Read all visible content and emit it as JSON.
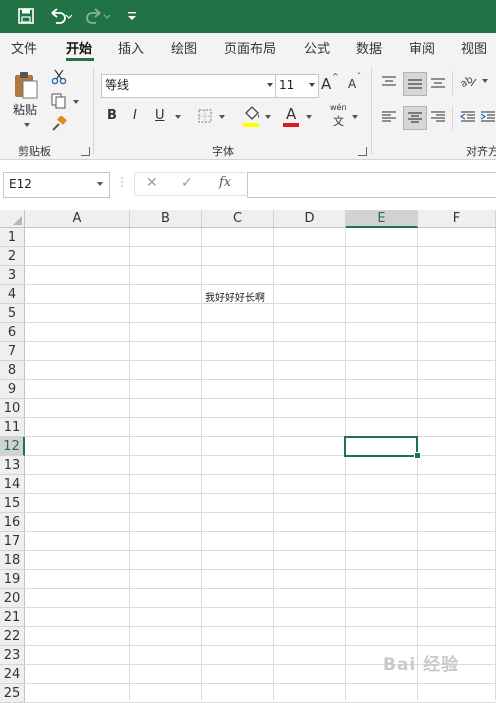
{
  "quick_access": {
    "icons": [
      "save-icon",
      "undo-icon",
      "redo-icon",
      "customize-icon"
    ]
  },
  "tabs": [
    "文件",
    "开始",
    "插入",
    "绘图",
    "页面布局",
    "公式",
    "数据",
    "审阅",
    "视图"
  ],
  "active_tab": "开始",
  "ribbon": {
    "clipboard": {
      "paste_label": "粘贴",
      "group_label": "剪贴板"
    },
    "font": {
      "font_name": "等线",
      "font_size": "11",
      "bold": "B",
      "italic": "I",
      "underline": "U",
      "grow": "A",
      "shrink": "A",
      "wen_top": "wén",
      "wen_bottom": "文",
      "group_label": "字体",
      "fill_color": "#ffff00",
      "font_color": "#e11919"
    },
    "alignment": {
      "group_label": "对齐方"
    }
  },
  "formula_bar": {
    "name_box": "E12",
    "fx": "fx",
    "formula_value": ""
  },
  "sheet": {
    "columns": [
      "A",
      "B",
      "C",
      "D",
      "E",
      "F"
    ],
    "rows": [
      "1",
      "2",
      "3",
      "4",
      "5",
      "6",
      "7",
      "8",
      "9",
      "10",
      "11",
      "12",
      "13",
      "14",
      "15",
      "16",
      "17",
      "18",
      "19",
      "20",
      "21",
      "22",
      "23",
      "24",
      "25"
    ],
    "selected_column": "E",
    "selected_row": "12",
    "cells": {
      "C4": "我好好好长啊"
    }
  },
  "watermark": "Bai 经验",
  "colors": {
    "accent": "#217346"
  }
}
